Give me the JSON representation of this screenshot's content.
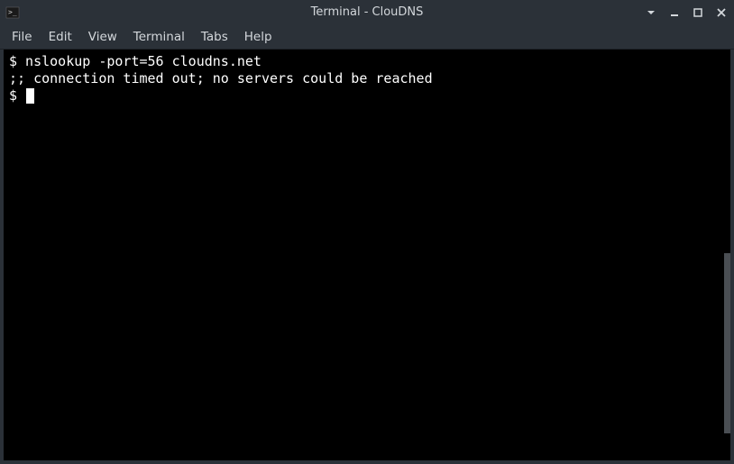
{
  "window": {
    "title": "Terminal - ClouDNS"
  },
  "menubar": {
    "items": [
      "File",
      "Edit",
      "View",
      "Terminal",
      "Tabs",
      "Help"
    ]
  },
  "terminal": {
    "prompt": "$",
    "lines": [
      "$ nslookup -port=56 cloudns.net",
      ";; connection timed out; no servers could be reached",
      "",
      "$ "
    ]
  }
}
